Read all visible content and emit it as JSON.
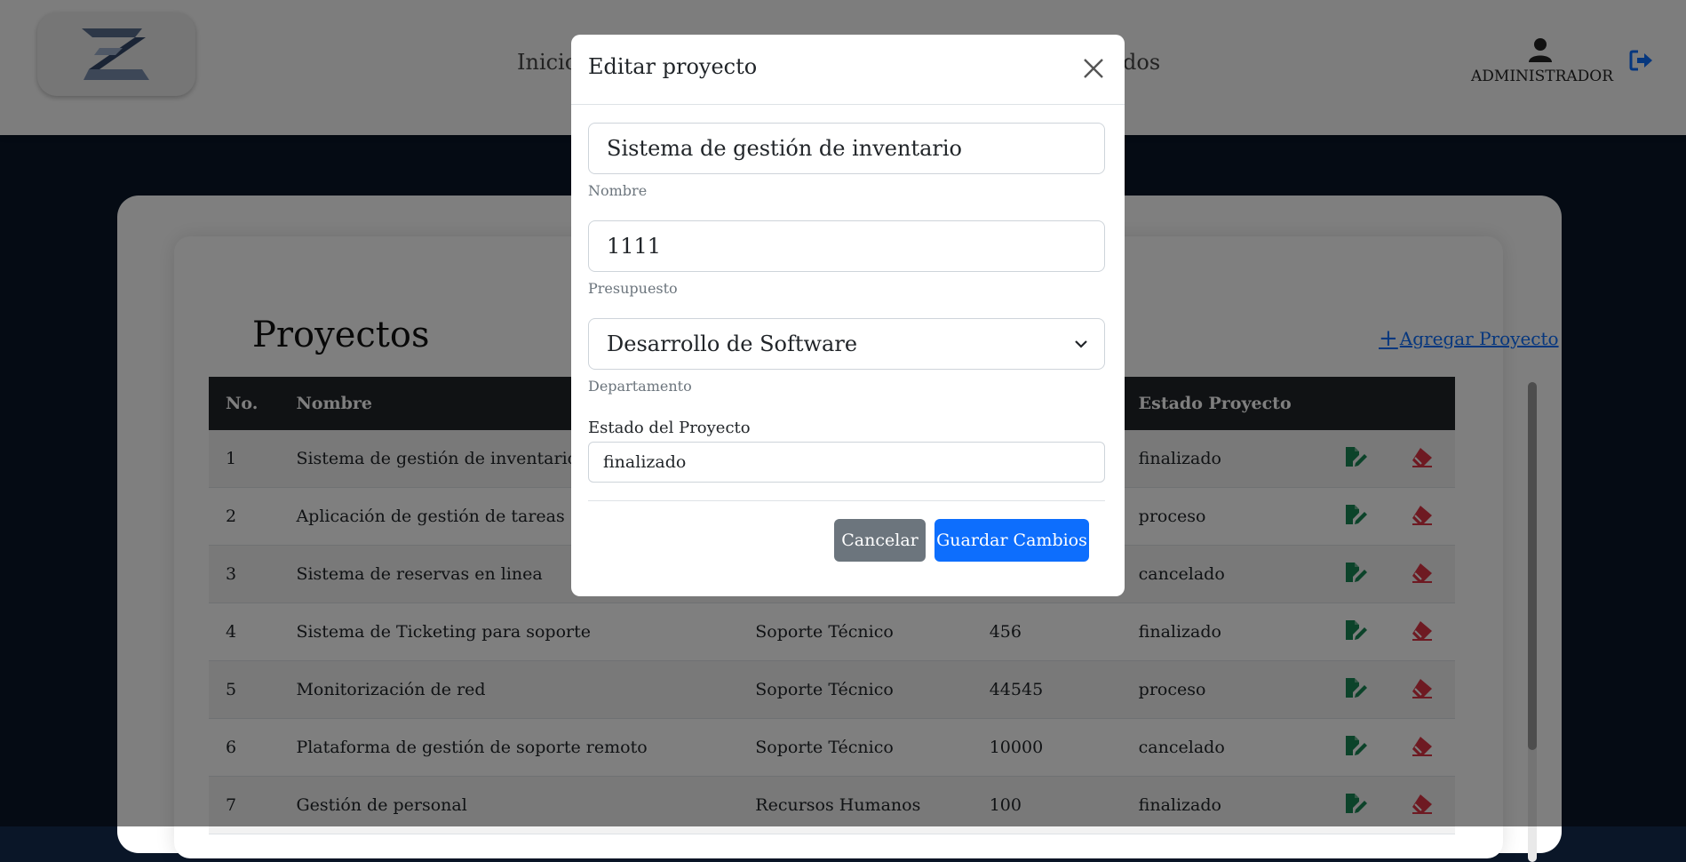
{
  "navbar": {
    "links": [
      "Inicio",
      "dos"
    ],
    "user_label": "ADMINISTRADOR",
    "user_icon": "user-icon",
    "logout_icon": "logout-icon"
  },
  "page": {
    "title": "Proyectos",
    "add_link": "Agregar Proyecto"
  },
  "table": {
    "headers": [
      "No.",
      "Nombre",
      "",
      "",
      "Estado Proyecto"
    ],
    "rows": [
      {
        "no": "1",
        "nombre": "Sistema de gestión de inventario",
        "departamento": "",
        "presupuesto": "",
        "estado": "finalizado"
      },
      {
        "no": "2",
        "nombre": "Aplicación de gestión de tareas",
        "departamento": "",
        "presupuesto": "",
        "estado": "proceso"
      },
      {
        "no": "3",
        "nombre": "Sistema de reservas en linea",
        "departamento": "",
        "presupuesto": "",
        "estado": "cancelado"
      },
      {
        "no": "4",
        "nombre": "Sistema de Ticketing para soporte",
        "departamento": "Soporte Técnico",
        "presupuesto": "456",
        "estado": "finalizado"
      },
      {
        "no": "5",
        "nombre": "Monitorización de red",
        "departamento": "Soporte Técnico",
        "presupuesto": "44545",
        "estado": "proceso"
      },
      {
        "no": "6",
        "nombre": "Plataforma de gestión de soporte remoto",
        "departamento": "Soporte Técnico",
        "presupuesto": "10000",
        "estado": "cancelado"
      },
      {
        "no": "7",
        "nombre": "Gestión de personal",
        "departamento": "Recursos Humanos",
        "presupuesto": "100",
        "estado": "finalizado"
      }
    ]
  },
  "modal": {
    "title": "Editar proyecto",
    "nombre_value": "Sistema de gestión de inventario",
    "nombre_label": "Nombre",
    "presupuesto_value": "1111",
    "presupuesto_label": "Presupuesto",
    "departamento_value": "Desarrollo de Software",
    "departamento_label": "Departamento",
    "estado_label": "Estado del Proyecto",
    "estado_value": "finalizado",
    "cancel_label": "Cancelar",
    "save_label": "Guardar Cambios"
  },
  "colors": {
    "edit_icon": "#198754",
    "delete_icon": "#dc3545",
    "primary": "#0d6efd",
    "secondary": "#6c757d"
  }
}
